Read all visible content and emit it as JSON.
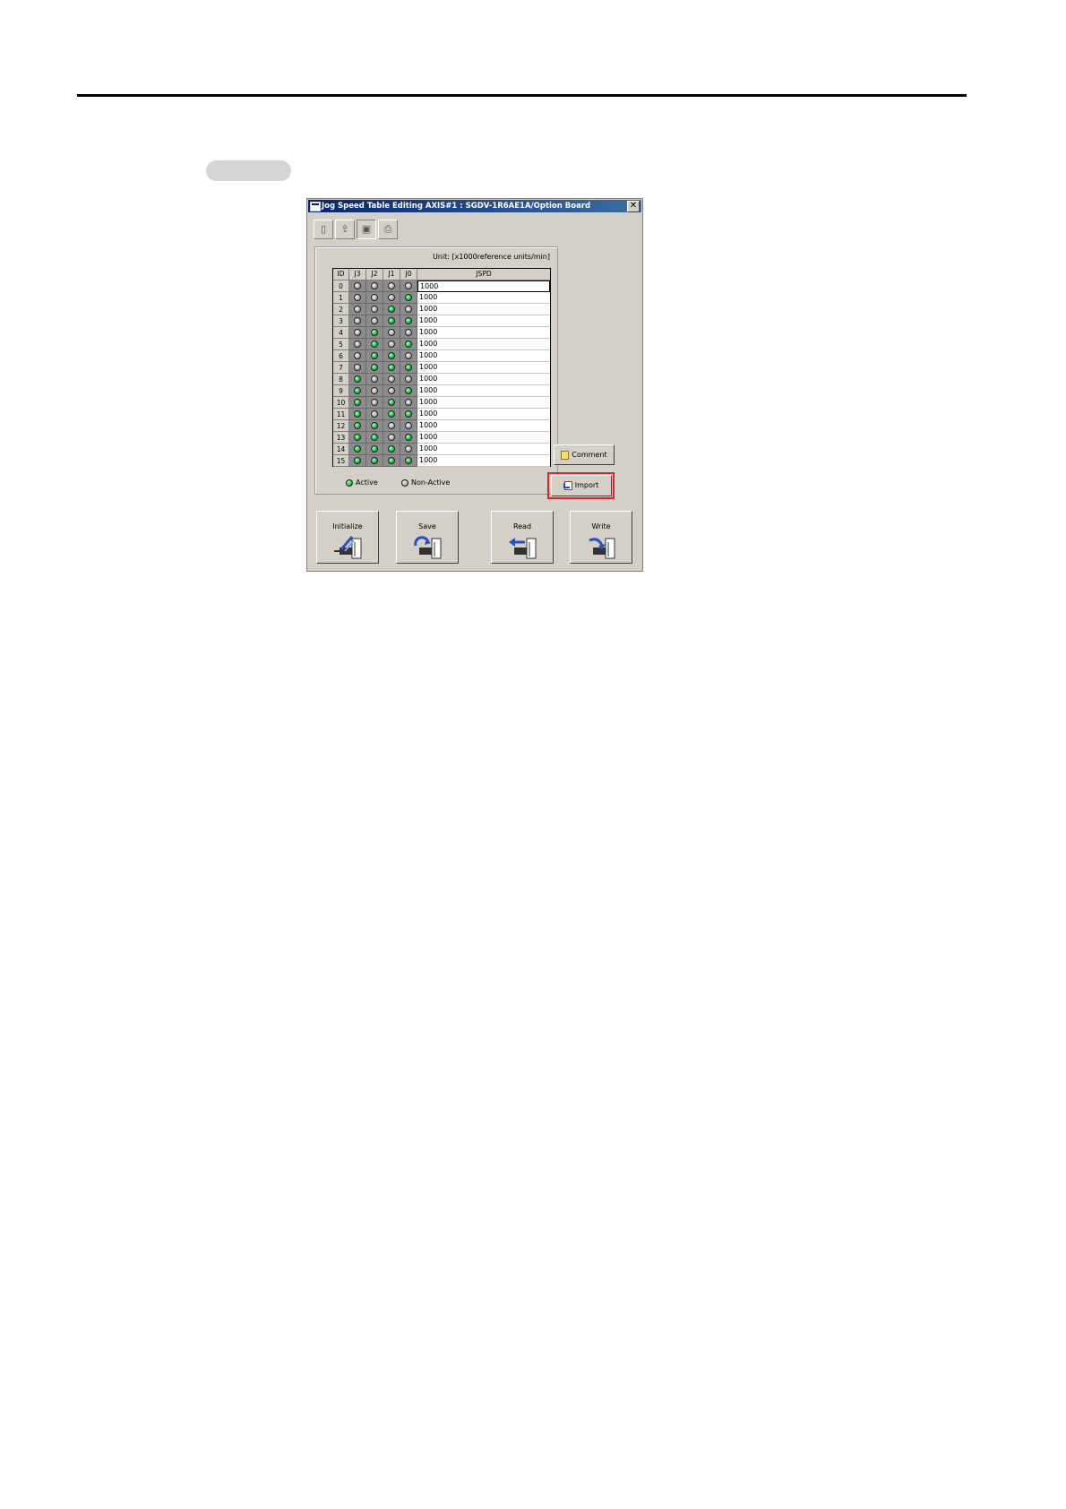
{
  "window": {
    "title": "Jog Speed Table Editing AXIS#1 : SGDV-1R6AE1A/Option Board",
    "close_glyph": "✕"
  },
  "toolbar": {
    "icons": [
      "new-file-icon",
      "open-file-icon",
      "save-file-icon",
      "print-icon"
    ]
  },
  "table": {
    "unit_label": "Unit: [x1000reference units/min]",
    "headers": {
      "id": "ID",
      "j3": "J3",
      "j2": "J2",
      "j1": "J1",
      "j0": "J0",
      "value": "JSPD"
    },
    "rows": [
      {
        "id": "0",
        "j3": false,
        "j2": false,
        "j1": false,
        "j0": false,
        "value": "1000"
      },
      {
        "id": "1",
        "j3": false,
        "j2": false,
        "j1": false,
        "j0": true,
        "value": "1000"
      },
      {
        "id": "2",
        "j3": false,
        "j2": false,
        "j1": true,
        "j0": false,
        "value": "1000"
      },
      {
        "id": "3",
        "j3": false,
        "j2": false,
        "j1": true,
        "j0": true,
        "value": "1000"
      },
      {
        "id": "4",
        "j3": false,
        "j2": true,
        "j1": false,
        "j0": false,
        "value": "1000"
      },
      {
        "id": "5",
        "j3": false,
        "j2": true,
        "j1": false,
        "j0": true,
        "value": "1000"
      },
      {
        "id": "6",
        "j3": false,
        "j2": true,
        "j1": true,
        "j0": false,
        "value": "1000"
      },
      {
        "id": "7",
        "j3": false,
        "j2": true,
        "j1": true,
        "j0": true,
        "value": "1000"
      },
      {
        "id": "8",
        "j3": true,
        "j2": false,
        "j1": false,
        "j0": false,
        "value": "1000"
      },
      {
        "id": "9",
        "j3": true,
        "j2": false,
        "j1": false,
        "j0": true,
        "value": "1000"
      },
      {
        "id": "10",
        "j3": true,
        "j2": false,
        "j1": true,
        "j0": false,
        "value": "1000"
      },
      {
        "id": "11",
        "j3": true,
        "j2": false,
        "j1": true,
        "j0": true,
        "value": "1000"
      },
      {
        "id": "12",
        "j3": true,
        "j2": true,
        "j1": false,
        "j0": false,
        "value": "1000"
      },
      {
        "id": "13",
        "j3": true,
        "j2": true,
        "j1": false,
        "j0": true,
        "value": "1000"
      },
      {
        "id": "14",
        "j3": true,
        "j2": true,
        "j1": true,
        "j0": false,
        "value": "1000"
      },
      {
        "id": "15",
        "j3": true,
        "j2": true,
        "j1": true,
        "j0": true,
        "value": "1000"
      }
    ]
  },
  "legend": {
    "active": "Active",
    "inactive": "Non-Active"
  },
  "side_buttons": {
    "comment": "Comment",
    "import": "Import"
  },
  "bottom_buttons": {
    "initialize": "Initialize",
    "save": "Save",
    "read": "Read",
    "write": "Write"
  },
  "colors": {
    "active_led": "#10c040",
    "inactive_led": "#b0b0b0",
    "highlight": "#e0202a",
    "titlebar": "#0a246a"
  }
}
